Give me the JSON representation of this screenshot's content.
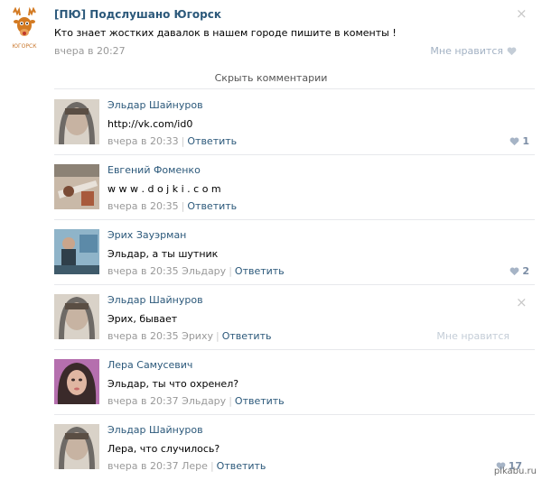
{
  "post": {
    "group_name": "[ПЮ] Подслушано Югорск",
    "group_logo_text": "ЮГОРСК",
    "text": "Кто знает жостких давалок в нашем городе пишите в коменты !",
    "time": "вчера в 20:27",
    "like_label": "Мне нравится"
  },
  "hide_comments": "Скрыть комментарии",
  "comments": [
    {
      "author": "Эльдар Шайнуров",
      "text": "http://vk.com/id0",
      "time": "вчера в 20:33",
      "reply_label": "Ответить",
      "likes": "1",
      "avatar_colors": [
        "#6e6a66",
        "#d9d2c8"
      ]
    },
    {
      "author": "Евгений Фоменко",
      "text": "w w w . d o j k i . c o m",
      "time": "вчера в 20:35",
      "reply_label": "Ответить",
      "avatar_colors": [
        "#c9b9a8",
        "#7a4b35"
      ]
    },
    {
      "author": "Эрих Зауэрман",
      "text": "Эльдар, а ты шутник",
      "time": "вчера в 20:35 Эльдару",
      "reply_label": "Ответить",
      "likes": "2",
      "avatar_colors": [
        "#5c8aa8",
        "#2f3f4a"
      ]
    },
    {
      "author": "Эльдар Шайнуров",
      "text": "Эрих, бывает",
      "time": "вчера в 20:35 Эриху",
      "reply_label": "Ответить",
      "like_label": "Мне нравится",
      "avatar_colors": [
        "#6e6a66",
        "#d9d2c8"
      ]
    },
    {
      "author": "Лера Самусевич",
      "text": "Эльдар, ты что охренел?",
      "time": "вчера в 20:37 Эльдару",
      "reply_label": "Ответить",
      "avatar_colors": [
        "#3a2a2a",
        "#c88f7c"
      ]
    },
    {
      "author": "Эльдар Шайнуров",
      "text": "Лера, что случилось?",
      "time": "вчера в 20:37 Лере",
      "reply_label": "Ответить",
      "likes": "17",
      "avatar_colors": [
        "#6e6a66",
        "#d9d2c8"
      ]
    }
  ],
  "watermark": "pikabu.ru",
  "colors": {
    "link": "#2b587a",
    "meta": "#999999",
    "like": "#7b8da5",
    "divider": "#e7e8ec"
  }
}
